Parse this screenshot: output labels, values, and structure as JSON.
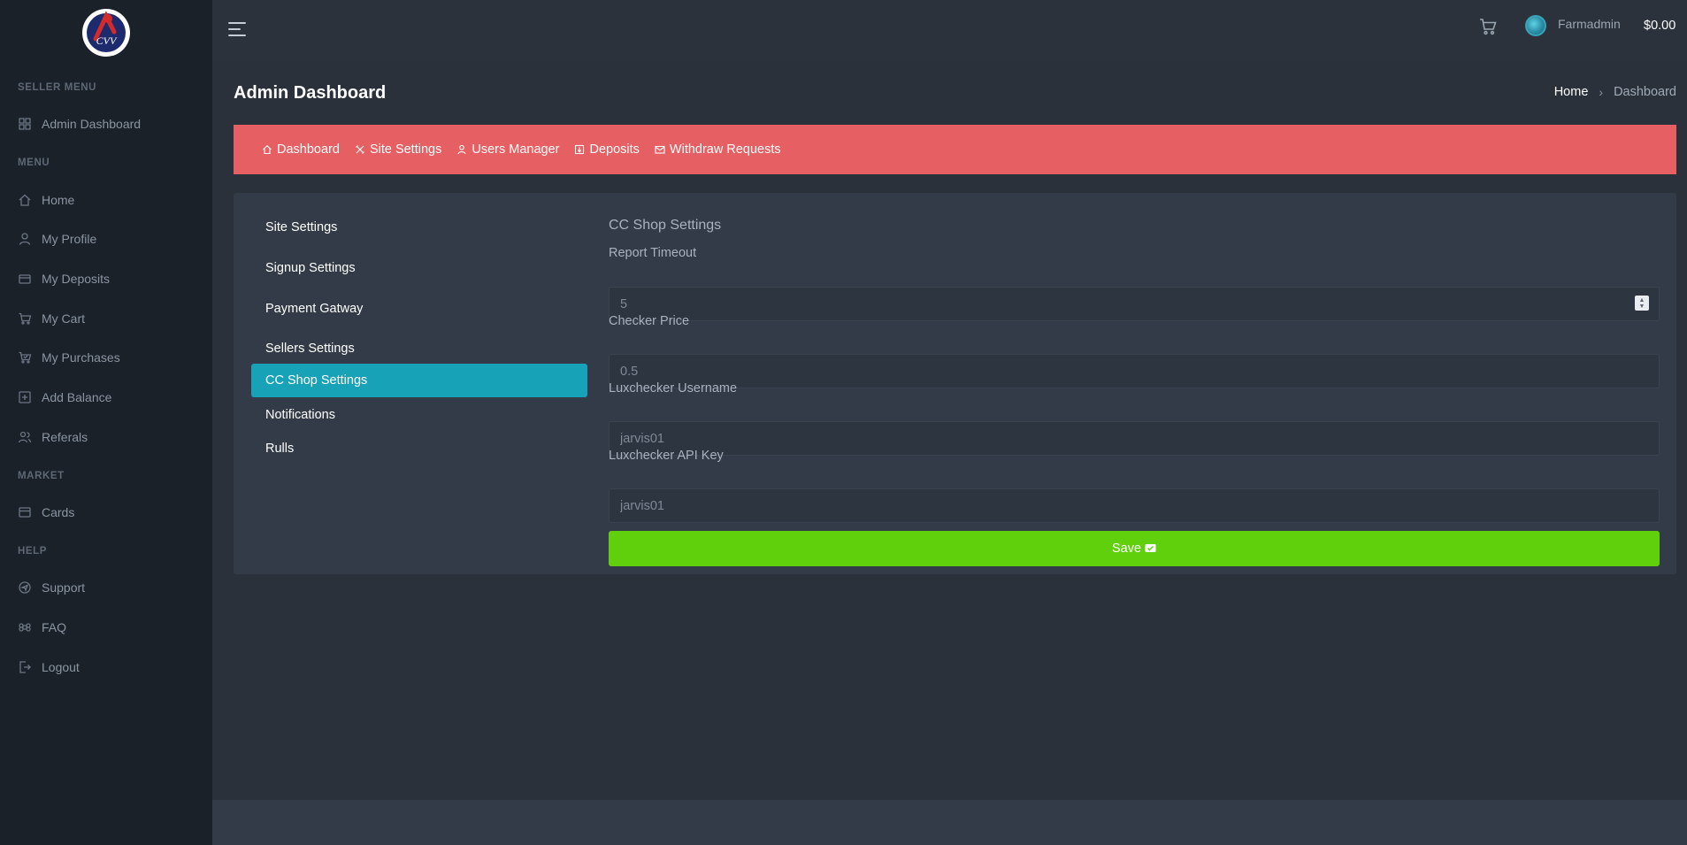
{
  "sidebar": {
    "logo_text": "CVV",
    "sections": [
      {
        "heading": "SELLER MENU",
        "items": [
          {
            "label": "Admin Dashboard",
            "icon": "grid-icon"
          }
        ]
      },
      {
        "heading": "MENU",
        "items": [
          {
            "label": "Home",
            "icon": "home-icon"
          },
          {
            "label": "My Profile",
            "icon": "user-icon"
          },
          {
            "label": "My Deposits",
            "icon": "wallet-icon"
          },
          {
            "label": "My Cart",
            "icon": "cart-icon"
          },
          {
            "label": "My Purchases",
            "icon": "cart-check-icon"
          },
          {
            "label": "Add Balance",
            "icon": "plus-square-icon"
          },
          {
            "label": "Referals",
            "icon": "users-icon"
          }
        ]
      },
      {
        "heading": "MARKET",
        "items": [
          {
            "label": "Cards",
            "icon": "card-icon"
          }
        ]
      },
      {
        "heading": "HELP",
        "items": [
          {
            "label": "Support",
            "icon": "support-icon"
          },
          {
            "label": "FAQ",
            "icon": "command-icon"
          },
          {
            "label": "Logout",
            "icon": "logout-icon"
          }
        ]
      }
    ]
  },
  "topbar": {
    "username": "Farmadmin",
    "balance": "$0.00"
  },
  "page": {
    "title": "Admin Dashboard",
    "breadcrumb": {
      "home": "Home",
      "separator": "›",
      "current": "Dashboard"
    }
  },
  "admin_nav": [
    {
      "label": "Dashboard",
      "icon": "home-icon"
    },
    {
      "label": "Site Settings",
      "icon": "tools-icon"
    },
    {
      "label": "Users Manager",
      "icon": "user-icon"
    },
    {
      "label": "Deposits",
      "icon": "deposit-icon"
    },
    {
      "label": "Withdraw Requests",
      "icon": "envelope-icon"
    }
  ],
  "settings_nav": {
    "items": [
      "Site Settings",
      "Signup Settings",
      "Payment Gatway",
      "Sellers Settings",
      "CC Shop Settings",
      "Notifications",
      "Rulls"
    ],
    "active": "CC Shop Settings"
  },
  "form": {
    "title": "CC Shop Settings",
    "fields": [
      {
        "label": "Report Timeout",
        "value": "5"
      },
      {
        "label": "Checker Price",
        "value": "0.5"
      },
      {
        "label": "Luxchecker Username",
        "value": "jarvis01"
      },
      {
        "label": "Luxchecker API Key",
        "value": "jarvis01"
      }
    ],
    "save_label": "Save"
  },
  "colors": {
    "sidebar_bg": "#1b2129",
    "body_bg": "#2a313b",
    "nav_red": "#e55f63",
    "active_teal": "#17a2b8",
    "save_green": "#61d00c"
  }
}
